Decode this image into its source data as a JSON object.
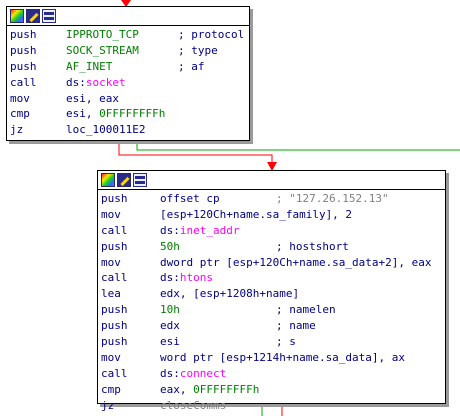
{
  "block1": {
    "lines": [
      {
        "mn": "push",
        "op": "IPPROTO_TCP",
        "op_style": "green",
        "cmt": "; protocol"
      },
      {
        "mn": "push",
        "op": "SOCK_STREAM",
        "op_style": "green",
        "cmt": "; type"
      },
      {
        "mn": "push",
        "op": "AF_INET",
        "op_style": "green",
        "cmt": "; af"
      },
      {
        "mn": "call",
        "op_pre": "ds:",
        "op": "socket",
        "op_style": "pink",
        "cmt": ""
      },
      {
        "mn": "mov",
        "op": "esi, eax",
        "op_style": "op",
        "cmt": ""
      },
      {
        "mn": "cmp",
        "op_pre": "esi, ",
        "op": "0FFFFFFFFh",
        "op_style": "green",
        "cmt": ""
      },
      {
        "mn": "jz",
        "op": "loc_100011E2",
        "op_style": "op",
        "cmt": ""
      }
    ]
  },
  "block2": {
    "lines": [
      {
        "mn": "push",
        "op": "offset cp",
        "op_style": "op",
        "cmt": "; \"127.26.152.13\"",
        "cmt_style": "gray"
      },
      {
        "mn": "mov",
        "op": "[esp+120Ch+name.sa_family], 2",
        "op_style": "op",
        "cmt": ""
      },
      {
        "mn": "call",
        "op_pre": "ds:",
        "op": "inet_addr",
        "op_style": "pink",
        "cmt": ""
      },
      {
        "mn": "push",
        "op": "50h",
        "op_style": "green",
        "cmt": "; hostshort"
      },
      {
        "mn": "mov",
        "op": "dword ptr [esp+120Ch+name.sa_data+2], eax",
        "op_style": "op",
        "cmt": ""
      },
      {
        "mn": "call",
        "op_pre": "ds:",
        "op": "htons",
        "op_style": "pink",
        "cmt": ""
      },
      {
        "mn": "lea",
        "op": "edx, [esp+1208h+name]",
        "op_style": "op",
        "cmt": ""
      },
      {
        "mn": "push",
        "op": "10h",
        "op_style": "green",
        "cmt": "; namelen"
      },
      {
        "mn": "push",
        "op": "edx",
        "op_style": "op",
        "cmt": "; name"
      },
      {
        "mn": "push",
        "op": "esi",
        "op_style": "op",
        "cmt": "; s"
      },
      {
        "mn": "mov",
        "op": "word ptr [esp+1214h+name.sa_data], ax",
        "op_style": "op",
        "cmt": ""
      },
      {
        "mn": "call",
        "op_pre": "ds:",
        "op": "connect",
        "op_style": "pink",
        "cmt": ""
      },
      {
        "mn": "cmp",
        "op_pre": "eax, ",
        "op": "0FFFFFFFFh",
        "op_style": "green",
        "cmt": ""
      },
      {
        "mn": "jz",
        "op": "closeComms",
        "op_style": "gray",
        "cmt": ""
      }
    ]
  },
  "colors": {
    "edge_red": "#ff0000",
    "edge_green": "#00aa00",
    "mnemonic": "#000080",
    "constant": "#008000",
    "import": "#ff00ff",
    "comment_string": "#808080"
  }
}
